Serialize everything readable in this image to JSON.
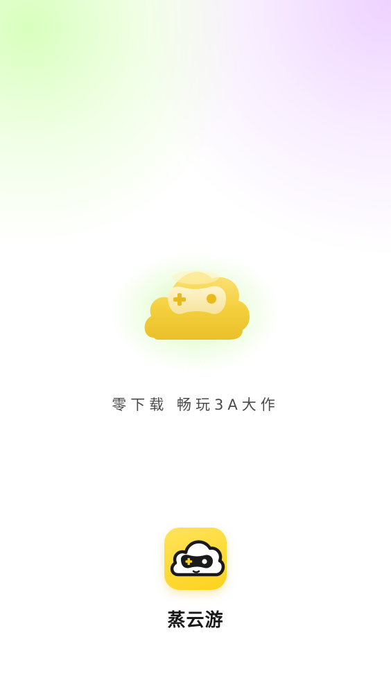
{
  "splash": {
    "tagline": "零下载 畅玩3A大作",
    "app_name": "蒸云游"
  },
  "icons": {
    "hero": "cloud-gamepad-icon",
    "app": "cloud-robot-icon"
  },
  "colors": {
    "brand_yellow": "#FBD21E",
    "glow_green": "#AAF06E",
    "corner_purple": "#ECCDFF",
    "text_dark": "#1A1A1A",
    "text_gray": "#4A4A4A"
  }
}
